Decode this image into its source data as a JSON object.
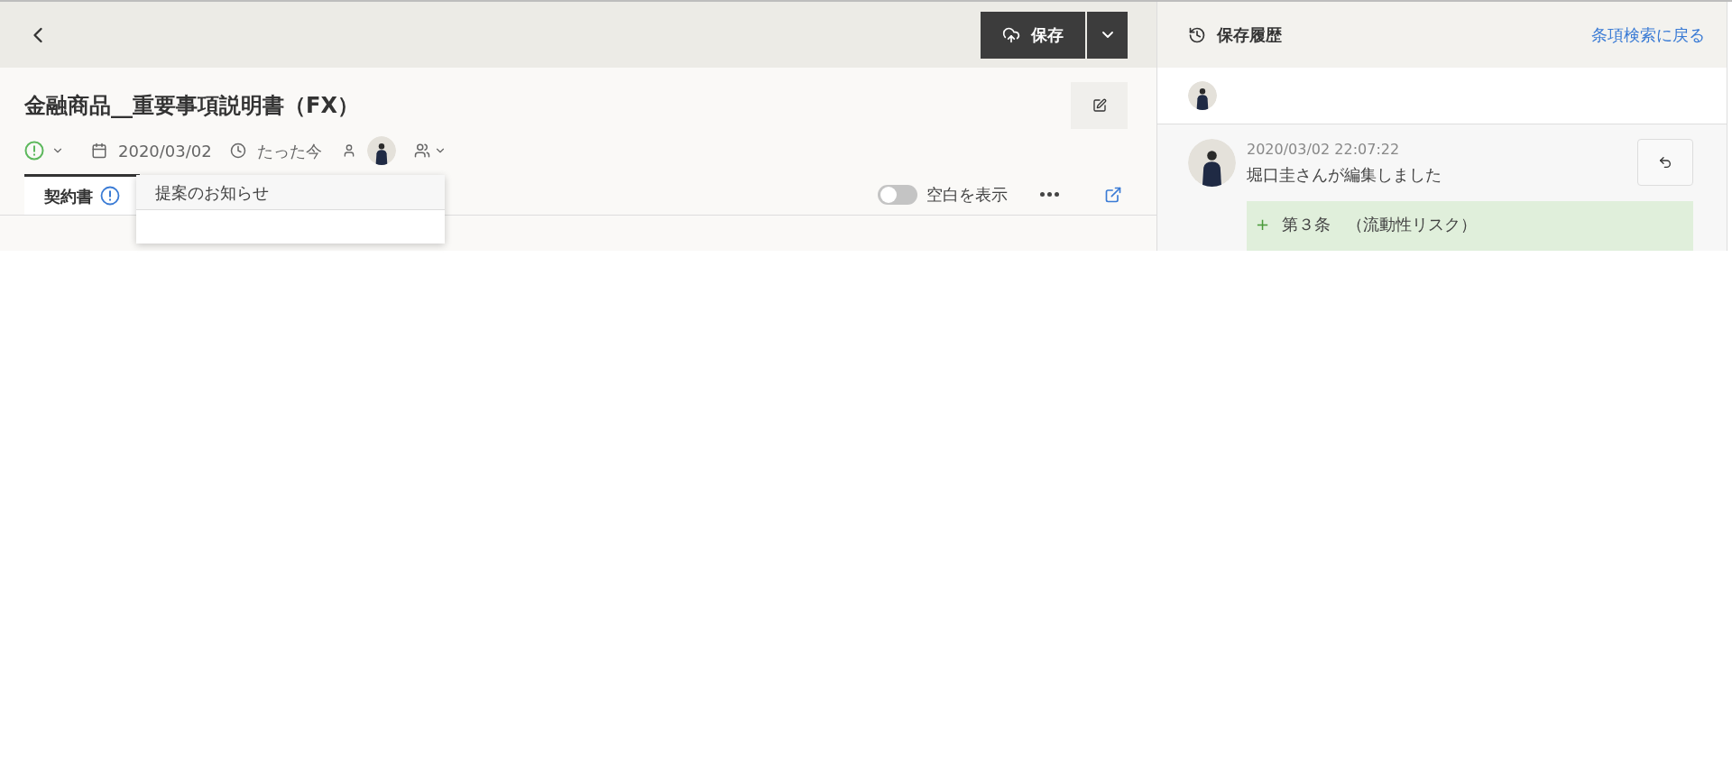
{
  "toolbar": {
    "save_button": "保存"
  },
  "document": {
    "title": "金融商品__重要事項説明書（FX）",
    "date": "2020/03/02",
    "updated": "たった今",
    "tabs": [
      {
        "label": "契約書",
        "selected": true
      }
    ],
    "popover": {
      "title": "提案のお知らせ"
    },
    "whitespace_toggle": {
      "label": "空白を表示",
      "on": false
    }
  },
  "history": {
    "title": "保存履歴",
    "back_link": "条項検索に戻る",
    "entries": [
      {
        "time": "2020/03/02 22:07:22",
        "message": "堀口圭さんが編集しました",
        "diff": [
          {
            "kind": "added",
            "marker": "+",
            "text": "第３条　（流動性リスク）"
          }
        ]
      }
    ]
  }
}
